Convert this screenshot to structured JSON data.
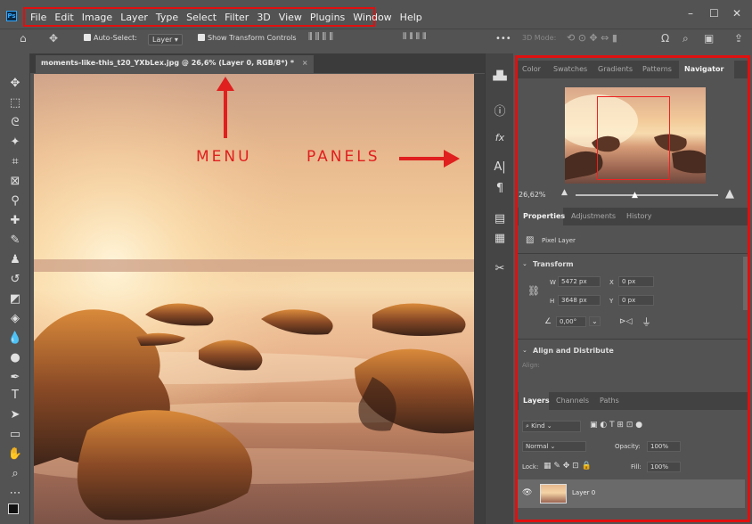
{
  "menubar": {
    "logo": "Ps",
    "items": [
      "File",
      "Edit",
      "Image",
      "Layer",
      "Type",
      "Select",
      "Filter",
      "3D",
      "View",
      "Plugins",
      "Window",
      "Help"
    ],
    "window_controls": [
      "–",
      "☐",
      "✕"
    ]
  },
  "options_bar": {
    "auto_select_label": "Auto-Select:",
    "auto_select_value": "Layer",
    "show_transform_label": "Show Transform Controls",
    "more_label": "•••",
    "mode_label": "3D Mode:"
  },
  "document": {
    "tab_title": "moments-like-this_t20_YXbLex.jpg @ 26,6% (Layer 0, RGB/8*) *",
    "close_glyph": "×"
  },
  "annotations": {
    "menu_label": "MENU",
    "panels_label": "PANELS"
  },
  "panel_group_top": {
    "tabs": [
      "Color",
      "Swatches",
      "Gradients",
      "Patterns",
      "Navigator"
    ],
    "active_tab": "Navigator",
    "zoom_value": "26,62%"
  },
  "panel_group_properties": {
    "tabs": [
      "Properties",
      "Adjustments",
      "History"
    ],
    "active_tab": "Properties",
    "pixel_layer_label": "Pixel Layer",
    "transform_heading": "Transform",
    "w_label": "W",
    "w_value": "5472 px",
    "h_label": "H",
    "h_value": "3648 px",
    "x_label": "X",
    "x_value": "0 px",
    "y_label": "Y",
    "y_value": "0 px",
    "angle_value": "0,00°",
    "align_heading": "Align and Distribute",
    "align_sub": "Align:"
  },
  "panel_group_layers": {
    "tabs": [
      "Layers",
      "Channels",
      "Paths"
    ],
    "active_tab": "Layers",
    "filter_kind": "Kind",
    "blend_mode": "Normal",
    "opacity_label": "Opacity:",
    "opacity_value": "100%",
    "lock_label": "Lock:",
    "fill_label": "Fill:",
    "fill_value": "100%",
    "layer_name": "Layer 0"
  },
  "colors": {
    "annotation_red": "#e01010",
    "ui_dark": "#535353",
    "accent_blue": "#31a8ff"
  }
}
